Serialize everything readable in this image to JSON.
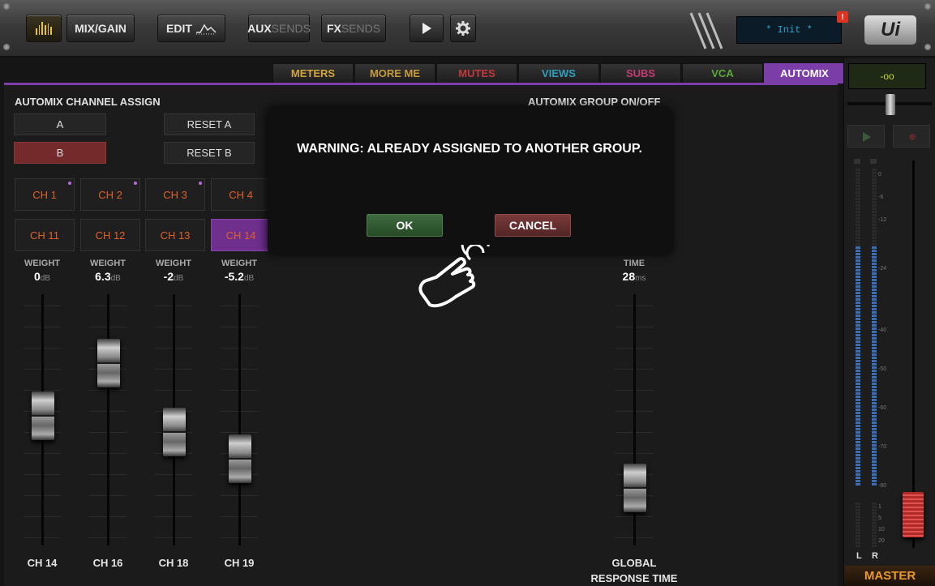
{
  "toolbar": {
    "meters_button": "meters",
    "mix_gain": "MIX/GAIN",
    "edit": "EDIT",
    "aux_bold": "AUX",
    "aux_dim": "SENDS",
    "fx_bold": "FX",
    "fx_dim": "SENDS",
    "lcd_text": "* Init *",
    "badge": "!",
    "logo": "Ui"
  },
  "tabs": [
    {
      "label": "METERS",
      "color": "#d2a53a"
    },
    {
      "label": "MORE ME",
      "color": "#c59a3c"
    },
    {
      "label": "MUTES",
      "color": "#c0383c"
    },
    {
      "label": "VIEWS",
      "color": "#2e9fbd"
    },
    {
      "label": "SUBS",
      "color": "#c03c70"
    },
    {
      "label": "VCA",
      "color": "#5aa73a"
    },
    {
      "label": "AUTOMIX",
      "color": "#ffffff",
      "active": true
    }
  ],
  "assign": {
    "title": "AUTOMIX CHANNEL ASSIGN",
    "btn_a": "A",
    "btn_b": "B",
    "reset_a": "RESET A",
    "reset_b": "RESET B"
  },
  "group_title": "AUTOMIX GROUP ON/OFF",
  "channels_row1": [
    "CH 1",
    "CH 2",
    "CH 3",
    "CH 4"
  ],
  "channels_row2": [
    "CH 11",
    "CH 12",
    "CH 13",
    "CH 14"
  ],
  "faders": [
    {
      "label": "WEIGHT",
      "value": "0",
      "unit": "dB",
      "name": "CH 14"
    },
    {
      "label": "WEIGHT",
      "value": "6.3",
      "unit": "dB",
      "name": "CH 16"
    },
    {
      "label": "WEIGHT",
      "value": "-2",
      "unit": "dB",
      "name": "CH 18"
    },
    {
      "label": "WEIGHT",
      "value": "-5.2",
      "unit": "dB",
      "name": "CH 19"
    }
  ],
  "time_fader": {
    "label": "TIME",
    "value": "28",
    "unit": "ms",
    "name_line1": "GLOBAL",
    "name_line2": "RESPONSE TIME"
  },
  "dialog": {
    "message": "WARNING: ALREADY ASSIGNED TO ANOTHER GROUP.",
    "ok": "OK",
    "cancel": "CANCEL"
  },
  "master": {
    "lcd": "-oo",
    "title": "MASTER",
    "left": "L",
    "right": "R",
    "scale": [
      "0",
      "-6",
      "-12",
      "-24",
      "-40",
      "-50",
      "-60",
      "-70",
      "-80"
    ],
    "scale_small": [
      "1",
      "5",
      "10",
      "20"
    ]
  }
}
